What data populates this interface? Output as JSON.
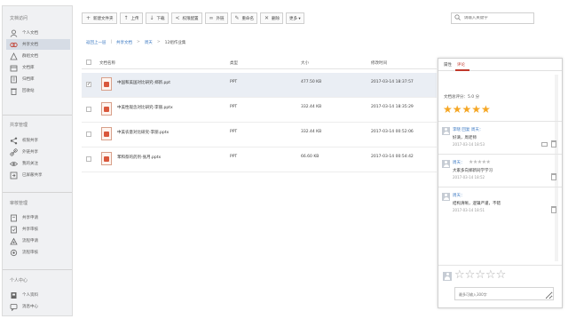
{
  "sidebar": {
    "sections": [
      {
        "title": "文档访问",
        "items": [
          {
            "label": "个人文档",
            "icon": "user-icon"
          },
          {
            "label": "共享文档",
            "icon": "share-folder-icon"
          },
          {
            "label": "群组文档",
            "icon": "group-icon"
          },
          {
            "label": "文档库",
            "icon": "library-icon"
          },
          {
            "label": "归档库",
            "icon": "archive-icon"
          },
          {
            "label": "回收站",
            "icon": "trash-icon"
          }
        ]
      },
      {
        "title": "共享管理",
        "items": [
          {
            "label": "权限共享",
            "icon": "share-icon"
          },
          {
            "label": "外链共享",
            "icon": "link-icon"
          },
          {
            "label": "我的关注",
            "icon": "eye-icon"
          },
          {
            "label": "已屏蔽共享",
            "icon": "block-icon"
          }
        ]
      },
      {
        "title": "审核管理",
        "items": [
          {
            "label": "共享申请",
            "icon": "apply-icon"
          },
          {
            "label": "共享审核",
            "icon": "audit-icon"
          },
          {
            "label": "流程申请",
            "icon": "flow-apply-icon"
          },
          {
            "label": "流程审核",
            "icon": "flow-audit-icon"
          }
        ]
      },
      {
        "title": "个人中心",
        "items": [
          {
            "label": "个人资料",
            "icon": "profile-icon"
          },
          {
            "label": "消息中心",
            "icon": "message-icon"
          }
        ]
      }
    ]
  },
  "toolbar": {
    "buttons": [
      {
        "label": "新建文件夹",
        "icon": "new-folder-icon",
        "glyph": "+"
      },
      {
        "label": "上传",
        "icon": "upload-icon",
        "glyph": "↑"
      },
      {
        "label": "下载",
        "icon": "download-icon",
        "glyph": "↓"
      },
      {
        "label": "权限配置",
        "icon": "share-icon",
        "glyph": "<"
      },
      {
        "label": "外链",
        "icon": "link-icon",
        "glyph": "∞"
      },
      {
        "label": "重命名",
        "icon": "rename-icon",
        "glyph": "✎"
      },
      {
        "label": "删除",
        "icon": "trash-icon",
        "glyph": "✕"
      },
      {
        "label": "更多 ▾",
        "icon": "more-icon",
        "glyph": ""
      }
    ]
  },
  "search": {
    "placeholder": "请输入关键字"
  },
  "breadcrumb": {
    "back": "返回上一层",
    "items": [
      "共享文档",
      "周天",
      "12组作业集"
    ]
  },
  "table": {
    "headers": {
      "name": "文档名称",
      "type": "类型",
      "size": "大小",
      "modified": "修改时间"
    },
    "rows": [
      {
        "name": "中国和美国对比研究-郑新.ppt",
        "type": "PPT",
        "size": "477.50 KB",
        "modified": "2017-03-14 18:37:57",
        "checked": "✓"
      },
      {
        "name": "中美性观念对比研究-李丽.pptx",
        "type": "PPT",
        "size": "332.44 KB",
        "modified": "2017-03-14 18:35:29",
        "checked": ""
      },
      {
        "name": "中美农意对比研究-李丽.pptx",
        "type": "PPT",
        "size": "332.44 KB",
        "modified": "2017-03-14 00:52:06",
        "checked": ""
      },
      {
        "name": "苯和萘的药剂-张月.pptx",
        "type": "PPT",
        "size": "66.60 KB",
        "modified": "2017-03-14 00:54:42",
        "checked": ""
      }
    ]
  },
  "panel": {
    "tabs": [
      "属性",
      "评论"
    ],
    "rating_label": "文档总评分：5.0 分",
    "rating_stars": "★★★★★",
    "comments": [
      {
        "author": "李晓  回复  周天：",
        "stars": "",
        "text": "好滴，周老师",
        "time": "2017-03-14 18:53"
      },
      {
        "author": "周天：",
        "stars": "★★★★★",
        "text": "大家多向郑新同学学习",
        "time": "2017-03-14 18:52"
      },
      {
        "author": "周天：",
        "stars": "",
        "text": "结构清晰，逻辑严谨，不错",
        "time": "2017-03-14 18:51"
      }
    ],
    "input_stars": "☆☆☆☆☆",
    "input_placeholder": "最多可输入300字"
  },
  "colors": {
    "accent": "#3a78c2",
    "active_tab": "#c0392b",
    "star": "#f5a623"
  }
}
